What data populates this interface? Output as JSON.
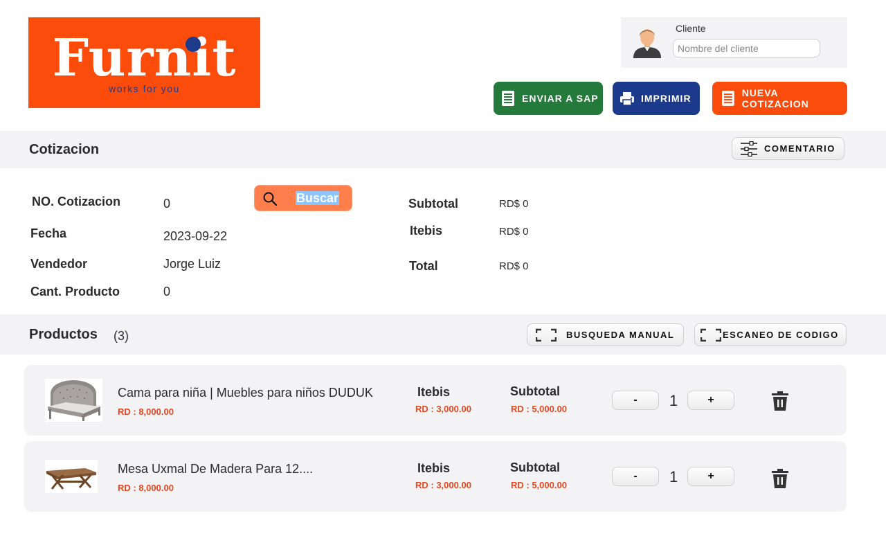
{
  "brand": {
    "name": "Furnit",
    "tagline": "works for you",
    "color": "#fc4c0c",
    "accent": "#1e3a8a"
  },
  "client": {
    "label": "Cliente",
    "placeholder": "Nombre del cliente",
    "value": "",
    "avatar_icon": "user-avatar-icon"
  },
  "actions": {
    "send_sap": {
      "label": "ENVIAR A SAP",
      "icon": "receipt-icon",
      "color": "#237a3a"
    },
    "print": {
      "label": "IMPRIMIR",
      "icon": "printer-icon",
      "color": "#1b3a8c"
    },
    "new_quote": {
      "label": "NUEVA COTIZACION",
      "icon": "receipt-icon",
      "color": "#fc4c0c"
    }
  },
  "quote_section": {
    "title": "Cotizacion",
    "comment_button": {
      "label": "COMENTARIO",
      "icon": "sliders-icon"
    }
  },
  "quote": {
    "number_label": "NO. Cotizacion",
    "number_value": "0",
    "search_button": {
      "label": "Buscar",
      "icon": "search-icon"
    },
    "date_label": "Fecha",
    "date_value": "2023-09-22",
    "seller_label": "Vendedor",
    "seller_value": "Jorge Luiz",
    "qty_label": "Cant. Producto",
    "qty_value": "0",
    "subtotal_label": "Subtotal",
    "subtotal_value": "RD$ 0",
    "itbis_label": "Itebis",
    "itbis_value": "RD$ 0",
    "total_label": "Total",
    "total_value": "RD$ 0"
  },
  "products_section": {
    "title": "Productos",
    "count": "(3)",
    "manual_search": {
      "label": "BUSQUEDA MANUAL",
      "icon": "scan-frame-icon"
    },
    "barcode_scan": {
      "label": "ESCANEO DE CODIGO",
      "icon": "scan-frame-icon"
    }
  },
  "products": [
    {
      "name": "Cama para niña | Muebles para niños DUDUK",
      "price": "RD : 8,000.00",
      "itbis_label": "Itebis",
      "itbis_value": "RD : 3,000.00",
      "subtotal_label": "Subtotal",
      "subtotal_value": "RD : 5,000.00",
      "minus": "-",
      "qty": "1",
      "plus": "+",
      "image_icon": "bed-image",
      "delete_icon": "trash-icon"
    },
    {
      "name": "Mesa Uxmal De Madera Para 12....",
      "price": "RD : 8,000.00",
      "itbis_label": "Itebis",
      "itbis_value": "RD : 3,000.00",
      "subtotal_label": "Subtotal",
      "subtotal_value": "RD : 5,000.00",
      "minus": "-",
      "qty": "1",
      "plus": "+",
      "image_icon": "table-image",
      "delete_icon": "trash-icon"
    }
  ]
}
